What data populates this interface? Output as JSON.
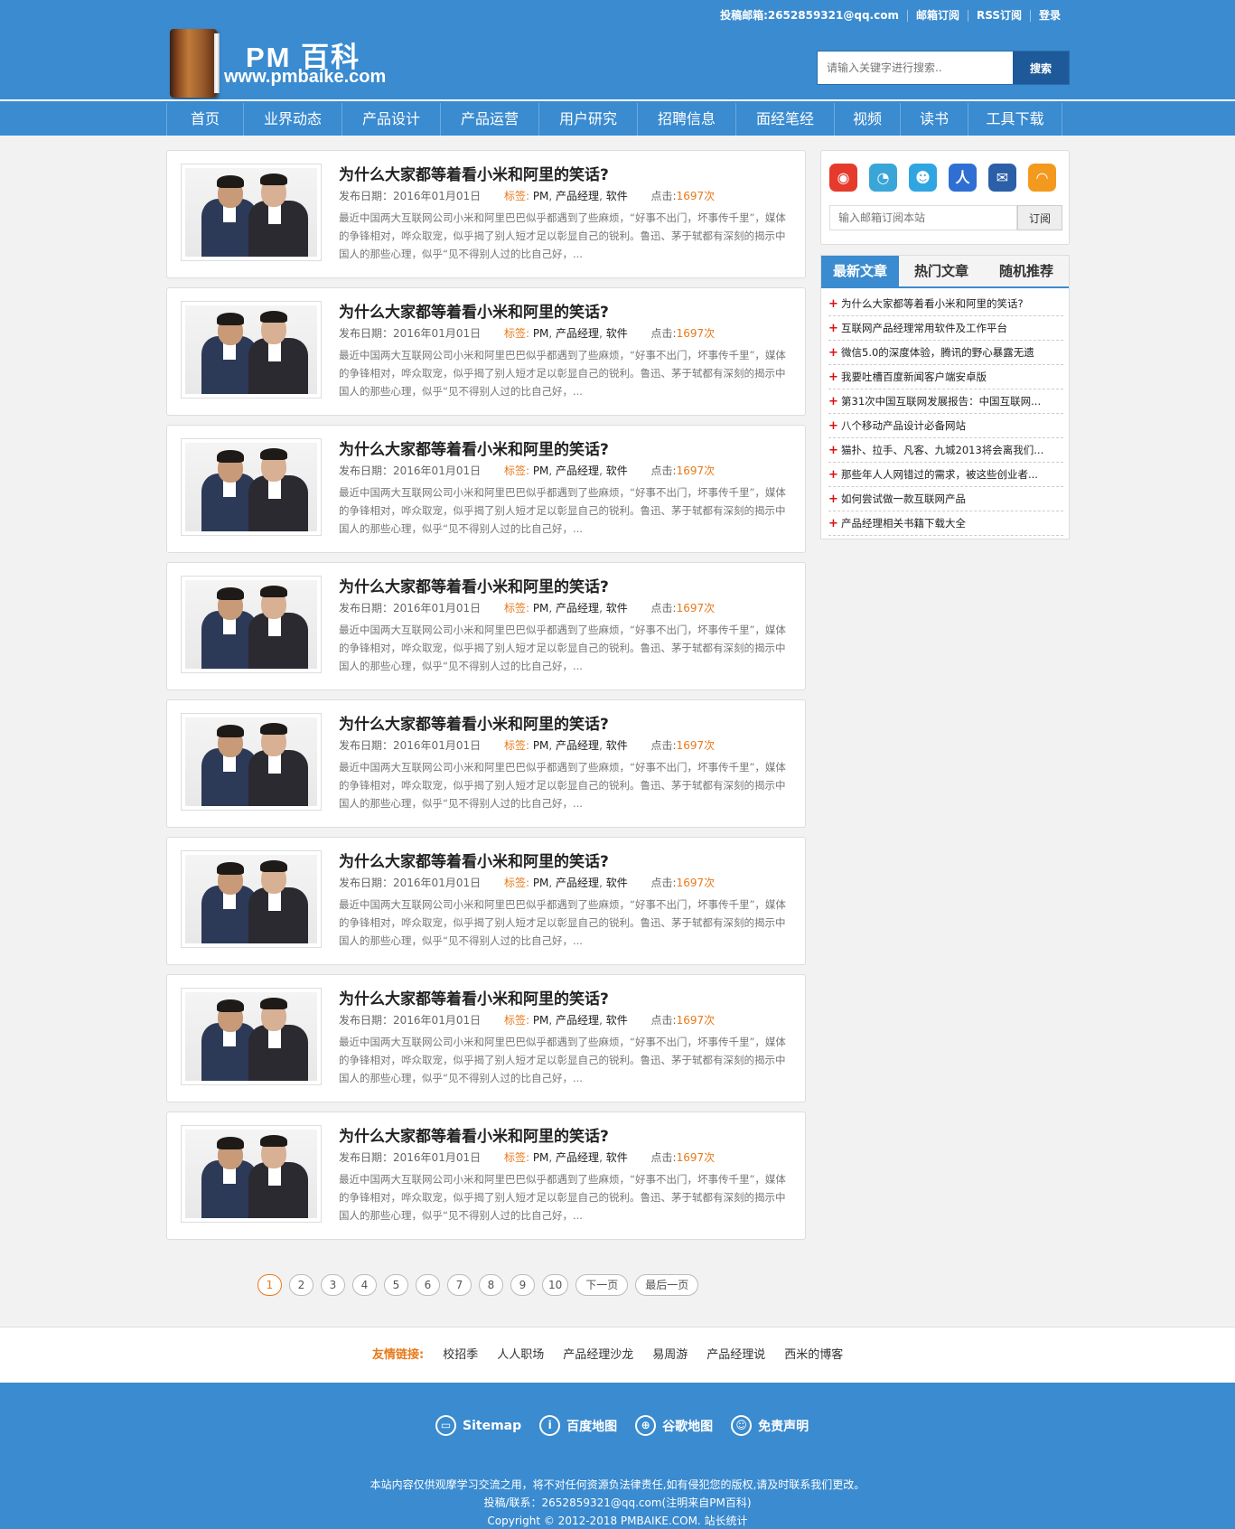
{
  "header": {
    "logo_title": "PM 百科",
    "logo_url": "www.pmbaike.com",
    "links": [
      "投稿邮箱:2652859321@qq.com",
      "邮箱订阅",
      "RSS订阅",
      "登录"
    ],
    "search_placeholder": "请输入关键字进行搜索..",
    "search_button": "搜索"
  },
  "nav": [
    "首页",
    "业界动态",
    "产品设计",
    "产品运营",
    "用户研究",
    "招聘信息",
    "面经笔经",
    "视频",
    "读书",
    "工具下载"
  ],
  "articles": [
    {
      "title": "为什么大家都等着看小米和阿里的笑话?",
      "date_label": "发布日期：",
      "date": "2016年01月01日",
      "tag_label": "标签:",
      "tags": [
        "PM",
        "产品经理",
        "软件"
      ],
      "clicks_label": "点击:",
      "clicks": "1697次",
      "desc": "最近中国两大互联网公司小米和阿里巴巴似乎都遇到了些麻烦，“好事不出门，坏事传千里”，媒体的争锋相对，哗众取宠，似乎揭了别人短才足以彰显自己的锐利。鲁迅、茅于轼都有深刻的揭示中国人的那些心理，似乎“见不得别人过的比自己好，..."
    },
    {
      "title": "为什么大家都等着看小米和阿里的笑话?",
      "date_label": "发布日期：",
      "date": "2016年01月01日",
      "tag_label": "标签:",
      "tags": [
        "PM",
        "产品经理",
        "软件"
      ],
      "clicks_label": "点击:",
      "clicks": "1697次",
      "desc": "最近中国两大互联网公司小米和阿里巴巴似乎都遇到了些麻烦，“好事不出门，坏事传千里”，媒体的争锋相对，哗众取宠，似乎揭了别人短才足以彰显自己的锐利。鲁迅、茅于轼都有深刻的揭示中国人的那些心理，似乎“见不得别人过的比自己好，..."
    },
    {
      "title": "为什么大家都等着看小米和阿里的笑话?",
      "date_label": "发布日期：",
      "date": "2016年01月01日",
      "tag_label": "标签:",
      "tags": [
        "PM",
        "产品经理",
        "软件"
      ],
      "clicks_label": "点击:",
      "clicks": "1697次",
      "desc": "最近中国两大互联网公司小米和阿里巴巴似乎都遇到了些麻烦，“好事不出门，坏事传千里”，媒体的争锋相对，哗众取宠，似乎揭了别人短才足以彰显自己的锐利。鲁迅、茅于轼都有深刻的揭示中国人的那些心理，似乎“见不得别人过的比自己好，..."
    },
    {
      "title": "为什么大家都等着看小米和阿里的笑话?",
      "date_label": "发布日期：",
      "date": "2016年01月01日",
      "tag_label": "标签:",
      "tags": [
        "PM",
        "产品经理",
        "软件"
      ],
      "clicks_label": "点击:",
      "clicks": "1697次",
      "desc": "最近中国两大互联网公司小米和阿里巴巴似乎都遇到了些麻烦，“好事不出门，坏事传千里”，媒体的争锋相对，哗众取宠，似乎揭了别人短才足以彰显自己的锐利。鲁迅、茅于轼都有深刻的揭示中国人的那些心理，似乎“见不得别人过的比自己好，..."
    },
    {
      "title": "为什么大家都等着看小米和阿里的笑话?",
      "date_label": "发布日期：",
      "date": "2016年01月01日",
      "tag_label": "标签:",
      "tags": [
        "PM",
        "产品经理",
        "软件"
      ],
      "clicks_label": "点击:",
      "clicks": "1697次",
      "desc": "最近中国两大互联网公司小米和阿里巴巴似乎都遇到了些麻烦，“好事不出门，坏事传千里”，媒体的争锋相对，哗众取宠，似乎揭了别人短才足以彰显自己的锐利。鲁迅、茅于轼都有深刻的揭示中国人的那些心理，似乎“见不得别人过的比自己好，..."
    },
    {
      "title": "为什么大家都等着看小米和阿里的笑话?",
      "date_label": "发布日期：",
      "date": "2016年01月01日",
      "tag_label": "标签:",
      "tags": [
        "PM",
        "产品经理",
        "软件"
      ],
      "clicks_label": "点击:",
      "clicks": "1697次",
      "desc": "最近中国两大互联网公司小米和阿里巴巴似乎都遇到了些麻烦，“好事不出门，坏事传千里”，媒体的争锋相对，哗众取宠，似乎揭了别人短才足以彰显自己的锐利。鲁迅、茅于轼都有深刻的揭示中国人的那些心理，似乎“见不得别人过的比自己好，..."
    },
    {
      "title": "为什么大家都等着看小米和阿里的笑话?",
      "date_label": "发布日期：",
      "date": "2016年01月01日",
      "tag_label": "标签:",
      "tags": [
        "PM",
        "产品经理",
        "软件"
      ],
      "clicks_label": "点击:",
      "clicks": "1697次",
      "desc": "最近中国两大互联网公司小米和阿里巴巴似乎都遇到了些麻烦，“好事不出门，坏事传千里”，媒体的争锋相对，哗众取宠，似乎揭了别人短才足以彰显自己的锐利。鲁迅、茅于轼都有深刻的揭示中国人的那些心理，似乎“见不得别人过的比自己好，..."
    },
    {
      "title": "为什么大家都等着看小米和阿里的笑话?",
      "date_label": "发布日期：",
      "date": "2016年01月01日",
      "tag_label": "标签:",
      "tags": [
        "PM",
        "产品经理",
        "软件"
      ],
      "clicks_label": "点击:",
      "clicks": "1697次",
      "desc": "最近中国两大互联网公司小米和阿里巴巴似乎都遇到了些麻烦，“好事不出门，坏事传千里”，媒体的争锋相对，哗众取宠，似乎揭了别人短才足以彰显自己的锐利。鲁迅、茅于轼都有深刻的揭示中国人的那些心理，似乎“见不得别人过的比自己好，..."
    }
  ],
  "pager": {
    "pages": [
      "1",
      "2",
      "3",
      "4",
      "5",
      "6",
      "7",
      "8",
      "9",
      "10"
    ],
    "current": "1",
    "next": "下一页",
    "last": "最后一页"
  },
  "sidebar": {
    "share_icons": [
      "weibo-icon",
      "tencent-weibo-icon",
      "qq-icon",
      "renren-icon",
      "email-icon",
      "rss-icon"
    ],
    "subscribe_placeholder": "输入邮箱订阅本站",
    "subscribe_button": "订阅",
    "tabs": [
      "最新文章",
      "热门文章",
      "随机推荐"
    ],
    "active_tab": "最新文章",
    "items": [
      "为什么大家都等着看小米和阿里的笑话?",
      "互联网产品经理常用软件及工作平台",
      "微信5.0的深度体验，腾讯的野心暴露无遗",
      "我要吐槽百度新闻客户端安卓版",
      "第31次中国互联网发展报告：中国互联网...",
      "八个移动产品设计必备网站",
      "猫扑、拉手、凡客、九城2013将会离我们...",
      "那些年人人网错过的需求，被这些创业者...",
      "如何尝试做一款互联网产品",
      "产品经理相关书籍下载大全"
    ]
  },
  "friends": {
    "label": "友情链接:",
    "links": [
      "校招季",
      "人人职场",
      "产品经理沙龙",
      "易周游",
      "产品经理说",
      "西米的博客"
    ]
  },
  "footer": {
    "nav": [
      "Sitemap",
      "百度地图",
      "谷歌地图",
      "免责声明"
    ],
    "line1": "本站内容仅供观摩学习交流之用，将不对任何资源负法律责任,如有侵犯您的版权,请及时联系我们更改。",
    "line2": "投稿/联系：2652859321@qq.com(注明来自PM百科)",
    "line3": "Copyright © 2012-2018 PMBAIKE.COM. 站长统计"
  },
  "colors": {
    "primary": "#3a8bd0",
    "accent": "#e77a1c",
    "bullet": "#dd1111"
  }
}
